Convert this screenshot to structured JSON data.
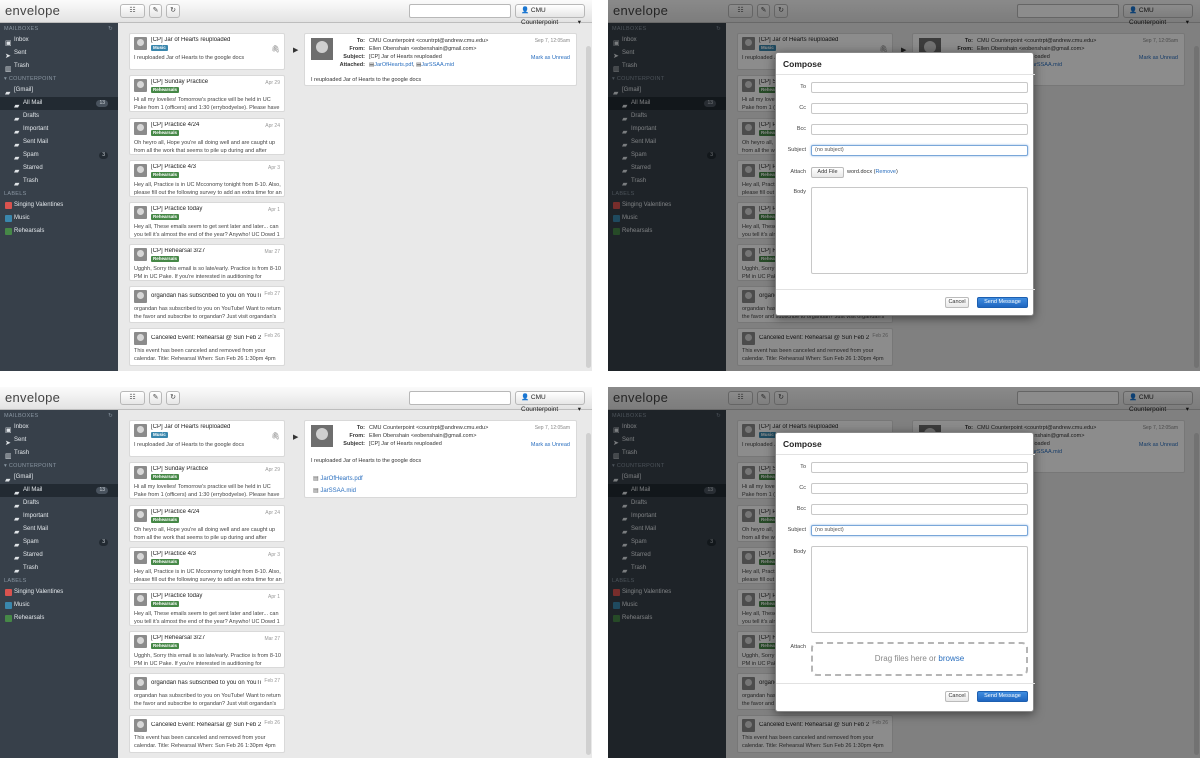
{
  "app": {
    "logo_text": "envelope",
    "account": "CMU Counterpoint"
  },
  "toolbar": {
    "icons": [
      "list-icon",
      "compose-icon",
      "refresh-icon"
    ]
  },
  "sidebar": {
    "mailboxes_header": "MAILBOXES",
    "inbox": "Inbox",
    "sent": "Sent",
    "trash": "Trash",
    "account_header": "COUNTERPOINT",
    "gmail": "[Gmail]",
    "all_mail": "All Mail",
    "all_mail_count": "13",
    "drafts": "Drafts",
    "important": "Important",
    "sent_mail": "Sent Mail",
    "spam": "Spam",
    "spam_count": "3",
    "starred": "Starred",
    "trash2": "Trash",
    "labels_header": "LABELS",
    "labels": [
      {
        "name": "Singing Valentines",
        "color": "#d9534f"
      },
      {
        "name": "Music",
        "color": "#3a87ad"
      },
      {
        "name": "Rehearsals",
        "color": "#468847"
      }
    ]
  },
  "messages": [
    {
      "subject": "[CP] Jar of Hearts reuploaded",
      "date": "",
      "badge": "Music",
      "badge_color": "#3a87ad",
      "preview": "I reuploaded Jar of Hearts to the google docs"
    },
    {
      "subject": "[CP] Sunday Practice",
      "date": "Apr 29",
      "badge": "Rehearsals",
      "badge_color": "#468847",
      "preview": "Hi all my lovelies! Tomorrow's practice will be held in UC Pake from 1 (officers) and 1:30 (errybodyelse). Please have new and"
    },
    {
      "subject": "[CP] Practice 4/24",
      "date": "Apr 24",
      "badge": "Rehearsals",
      "badge_color": "#468847",
      "preview": "Oh heyro all, Hope you're all doing well and are caught up from all the work that seems to pile up during and after Carnival."
    },
    {
      "subject": "[CP] Practice 4/3",
      "date": "Apr 3",
      "badge": "Rehearsals",
      "badge_color": "#468847",
      "preview": "Hey all, Practice is in UC Mcconomy tonight from 8-10. Also, please fill out the following survey to add an extra time for an"
    },
    {
      "subject": "[CP] Practice today",
      "date": "Apr 1",
      "badge": "Rehearsals",
      "badge_color": "#468847",
      "preview": "Hey all, These emails seem to get sent later and later... can you tell it's almost the end of the year? Anywho! UC Dowd 1 PM for"
    },
    {
      "subject": "[CP] Rehearsal 3/27",
      "date": "Mar 27",
      "badge": "Rehearsals",
      "badge_color": "#468847",
      "preview": "Ugghh, Sorry this email is so late/early. Practice is from 8-10 PM in UC Pake. If you're interested in auditioning for Battlefield,"
    },
    {
      "subject": "organdan has subscribed to you on YouTube",
      "date": "Feb 27",
      "badge": "",
      "badge_color": "",
      "preview": "organdan has subscribed to you on YouTube! Want to return the favor and subscribe to organdan? Just visit organdan's channel"
    },
    {
      "subject": "Canceled Event: Rehearsal @ Sun Feb 26 1:30pm",
      "date": "Feb 26",
      "badge": "",
      "badge_color": "",
      "preview": "This event has been canceled and removed from your calendar. Title: Rehearsal When: Sun Feb 26 1:30pm 4pm Eastern Time"
    }
  ],
  "message_view": {
    "to_label": "To:",
    "to": "CMU Counterpoint <countrpt@andrew.cmu.edu>",
    "from_label": "From:",
    "from": "Ellen Obenshain <eobenshain@gmail.com>",
    "subject_label": "Subject:",
    "subject": "[CP] Jar of Hearts reuploaded",
    "attached_label": "Attached:",
    "date": "Sep 7, 12:05am",
    "mark_unread": "Mark as Unread",
    "body": "I reuploaded Jar of Hearts to the google docs",
    "attachments": [
      "JarOfHearts.pdf",
      "JarSSAA.mid"
    ]
  },
  "compose": {
    "title": "Compose",
    "to_label": "To",
    "cc_label": "Cc",
    "bcc_label": "Bcc",
    "subject_label": "Subject",
    "subject_value": "(no subject)",
    "attach_label": "Attach",
    "add_file": "Add File",
    "attached_file": "word.docx",
    "remove": "Remove",
    "body_label": "Body",
    "drop_text": "Drag files here or",
    "browse": "browse",
    "cancel": "Cancel",
    "send": "Send Message"
  }
}
